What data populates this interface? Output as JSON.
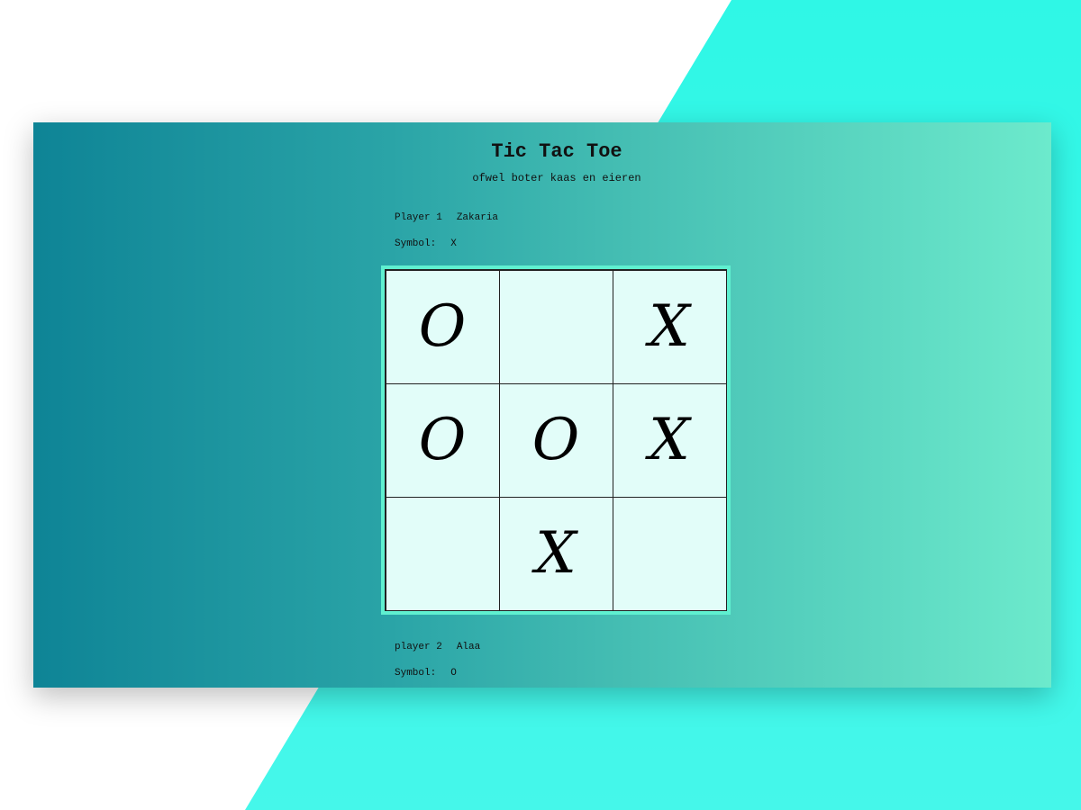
{
  "header": {
    "title": "Tic Tac Toe",
    "subtitle": "ofwel boter kaas en eieren"
  },
  "player1": {
    "label": "Player 1",
    "name": "Zakaria",
    "symbol_label": "Symbol:",
    "symbol": "X"
  },
  "player2": {
    "label": "player 2",
    "name": "Alaa",
    "symbol_label": "Symbol:",
    "symbol": "O"
  },
  "board": {
    "cells": [
      "O",
      "",
      "X",
      "O",
      "O",
      "X",
      "",
      "X",
      ""
    ]
  },
  "colors": {
    "background_accent": "#3ff5e6",
    "card_gradient_start": "#0e8496",
    "card_gradient_end": "#6ceacc",
    "board_frame": "#5ff0d0",
    "cell_background": "#e2fdf9"
  }
}
